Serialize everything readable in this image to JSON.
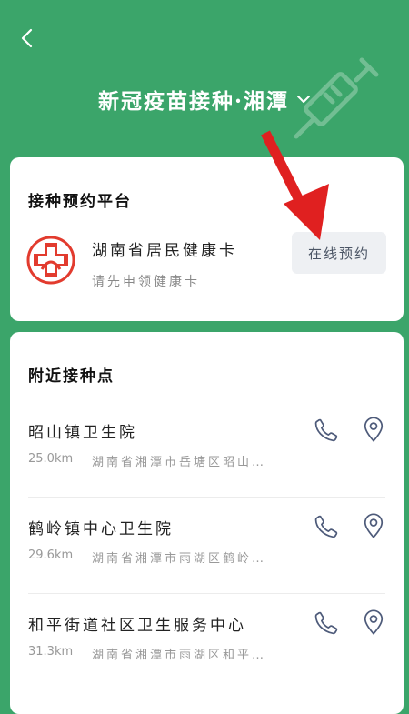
{
  "header": {
    "title": "新冠疫苗接种·湘潭",
    "back_icon": "chevron-left-icon",
    "dropdown_icon": "chevron-down-icon"
  },
  "booking_card": {
    "section_title": "接种预约平台",
    "name": "湖南省居民健康卡",
    "subtitle": "请先申领健康卡",
    "button_label": "在线预约"
  },
  "nearby": {
    "section_title": "附近接种点",
    "sites": [
      {
        "name": "昭山镇卫生院",
        "distance": "25.0km",
        "address": "湖南省湘潭市岳塘区昭山…"
      },
      {
        "name": "鹤岭镇中心卫生院",
        "distance": "29.6km",
        "address": "湖南省湘潭市雨湖区鹤岭…"
      },
      {
        "name": "和平街道社区卫生服务中心",
        "distance": "31.3km",
        "address": "湖南省湘潭市雨湖区和平…"
      }
    ]
  },
  "colors": {
    "background": "#3ba56a",
    "card": "#ffffff",
    "annotation_arrow": "#e02020",
    "logo_red": "#e23b2e"
  }
}
